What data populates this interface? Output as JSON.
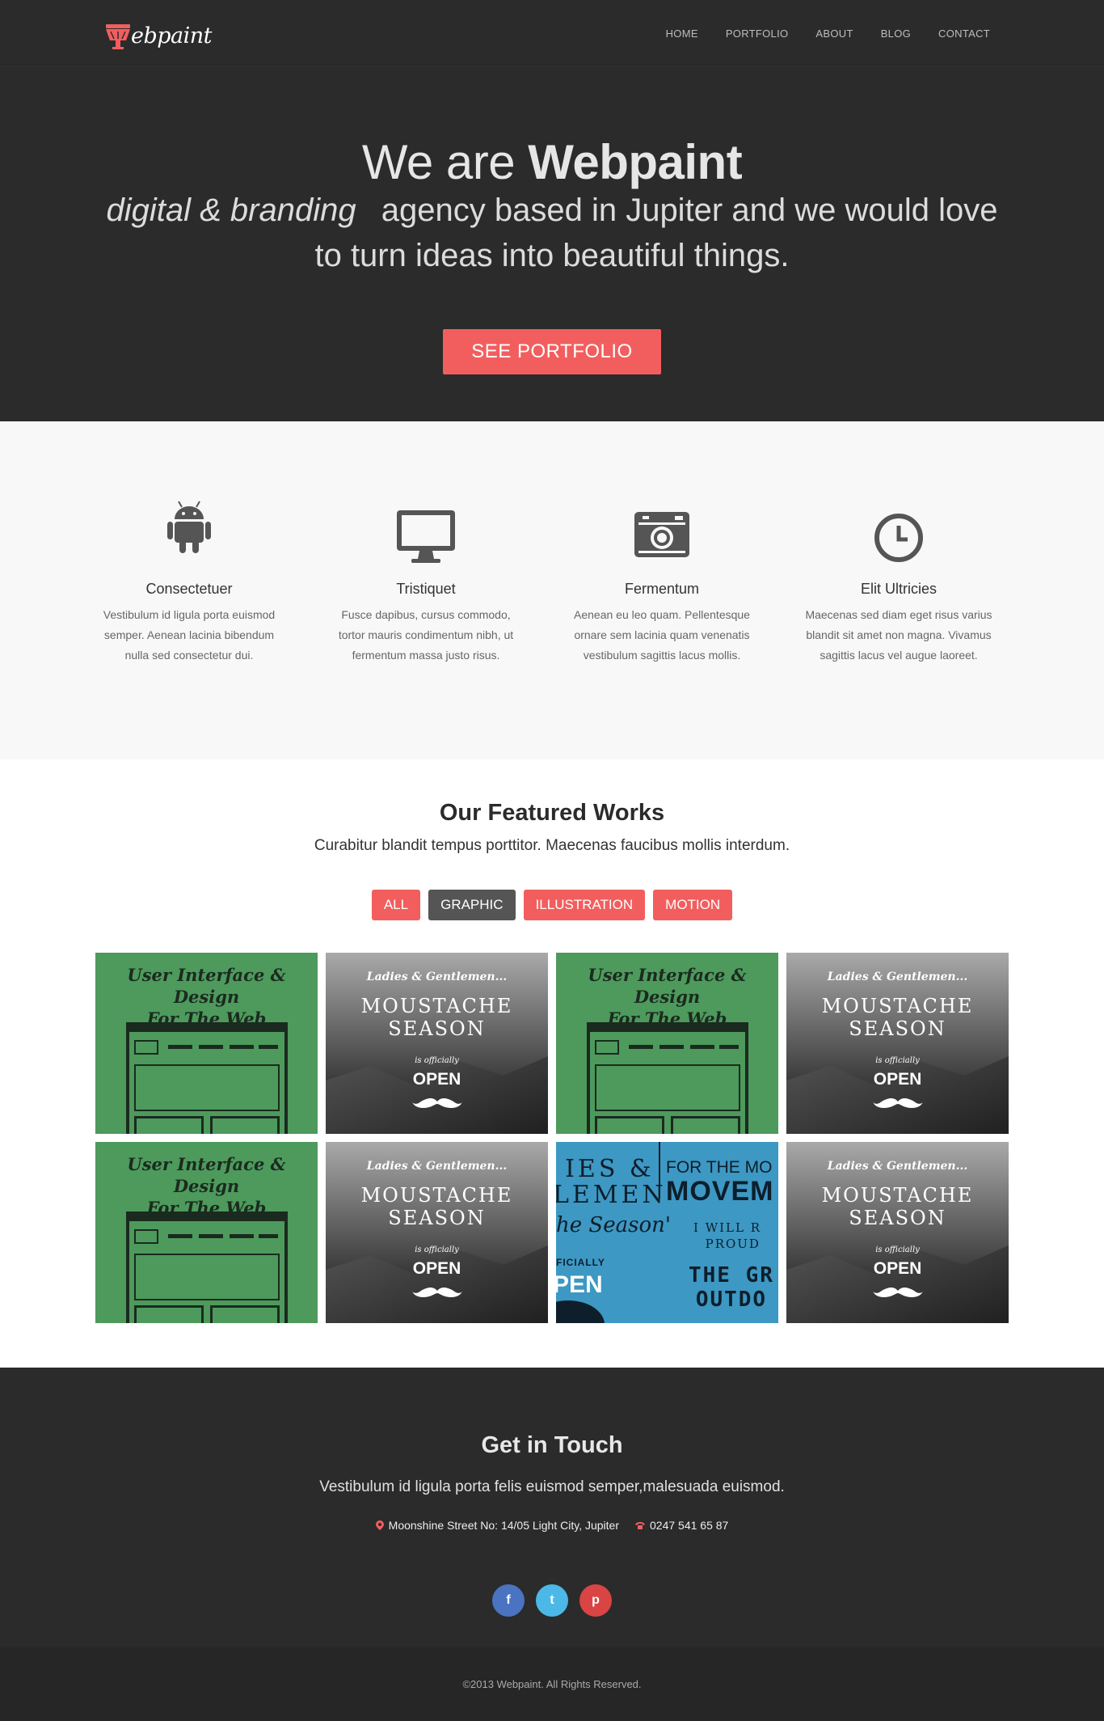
{
  "nav": {
    "logo_text": "ebpaint",
    "logo_initial": "W",
    "items": [
      "HOME",
      "PORTFOLIO",
      "ABOUT",
      "BLOG",
      "CONTACT"
    ]
  },
  "hero": {
    "title_prefix": "We are",
    "title_brand": "Webpaint",
    "tagline_italic": "digital & branding",
    "tagline_rest": "agency based in Jupiter and we would love to turn ideas into beautiful things.",
    "cta": "SEE PORTFOLIO"
  },
  "features": [
    {
      "icon": "android-icon",
      "title": "Consectetuer",
      "text": "Vestibulum id ligula porta euismod semper. Aenean lacinia bibendum nulla sed consectetur dui."
    },
    {
      "icon": "monitor-icon",
      "title": "Tristiquet",
      "text": "Fusce dapibus, cursus commodo, tortor mauris condimentum nibh, ut fermentum massa justo risus."
    },
    {
      "icon": "camera-icon",
      "title": "Fermentum",
      "text": "Aenean eu leo quam. Pellentesque ornare sem lacinia quam venenatis vestibulum sagittis lacus mollis."
    },
    {
      "icon": "clock-icon",
      "title": "Elit Ultricies",
      "text": "Maecenas sed diam eget risus varius blandit sit amet non magna. Vivamus sagittis lacus vel augue laoreet."
    }
  ],
  "works": {
    "title": "Our Featured Works",
    "subtitle": "Curabitur blandit tempus porttitor. Maecenas faucibus mollis interdum.",
    "filters": [
      "ALL",
      "GRAPHIC",
      "ILLUSTRATION",
      "MOTION"
    ],
    "active_filter": "GRAPHIC",
    "green_tile": {
      "line1": "User Interface & Design",
      "line2": "For The Web"
    },
    "grey_tile": {
      "line1": "Ladies & Gentlemen...",
      "line2": "MOUSTACHE",
      "line3": "SEASON",
      "line4": "is officially",
      "line5": "OPEN"
    },
    "blue_tile": {
      "left1": "IES &",
      "left2": "LEMEN",
      "left3": "he Season'",
      "left4": "FICIALLY",
      "left5": "PEN",
      "right1": "FOR THE MO",
      "right2": "MOVEM",
      "right3": "I WILL R",
      "right4": "PROUD",
      "right5": "THE GR",
      "right6": "OUTDO"
    }
  },
  "contact": {
    "title": "Get in Touch",
    "lead": "Vestibulum id ligula porta felis euismod semper,malesuada euismod.",
    "address": "Moonshine Street No: 14/05 Light City, Jupiter",
    "phone": "0247 541 65 87",
    "socials": [
      {
        "name": "facebook-icon",
        "glyph": "f",
        "color": "#4a73c2"
      },
      {
        "name": "tumblr-icon",
        "glyph": "t",
        "color": "#4bb8e8"
      },
      {
        "name": "pinterest-icon",
        "glyph": "p",
        "color": "#d94545"
      }
    ]
  },
  "footer": {
    "copyright": "©2013 Webpaint. All Rights Reserved."
  },
  "colors": {
    "accent": "#f25e5e",
    "dark": "#2b2b2b",
    "light": "#f8f8f8"
  }
}
